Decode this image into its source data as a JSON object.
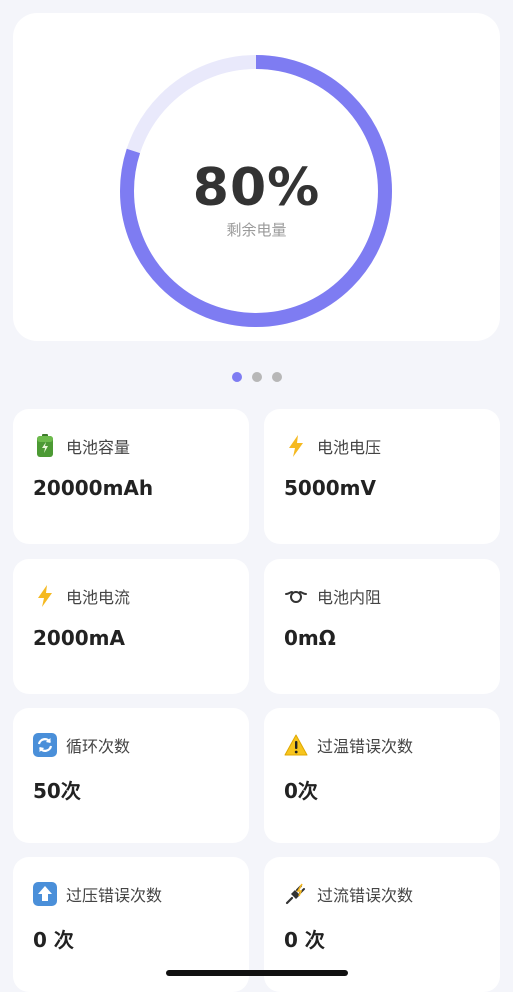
{
  "battery": {
    "percent_text": "80%",
    "percent": 80,
    "label": "剩余电量",
    "ring_color": "#7e7cf2",
    "track_color": "#e9e9fb"
  },
  "pager": {
    "count": 3,
    "active_index": 0
  },
  "stats": [
    {
      "name": "capacity",
      "icon": "battery-icon",
      "label": "电池容量",
      "value": "20000mAh"
    },
    {
      "name": "voltage",
      "icon": "lightning-icon",
      "label": "电池电压",
      "value": "5000mV"
    },
    {
      "name": "current",
      "icon": "lightning-icon",
      "label": "电池电流",
      "value": "2000mA"
    },
    {
      "name": "resistance",
      "icon": "resistance-icon",
      "label": "电池内阻",
      "value": "0mΩ"
    },
    {
      "name": "cycle-count",
      "icon": "cycle-icon",
      "label": "循环次数",
      "value": "50次"
    },
    {
      "name": "over-temp-errors",
      "icon": "warning-icon",
      "label": "过温错误次数",
      "value": "0次"
    },
    {
      "name": "over-voltage-errors",
      "icon": "up-arrow-icon",
      "label": "过压错误次数",
      "value": "0 次"
    },
    {
      "name": "over-current-errors",
      "icon": "plug-icon",
      "label": "过流错误次数",
      "value": "0 次"
    }
  ]
}
